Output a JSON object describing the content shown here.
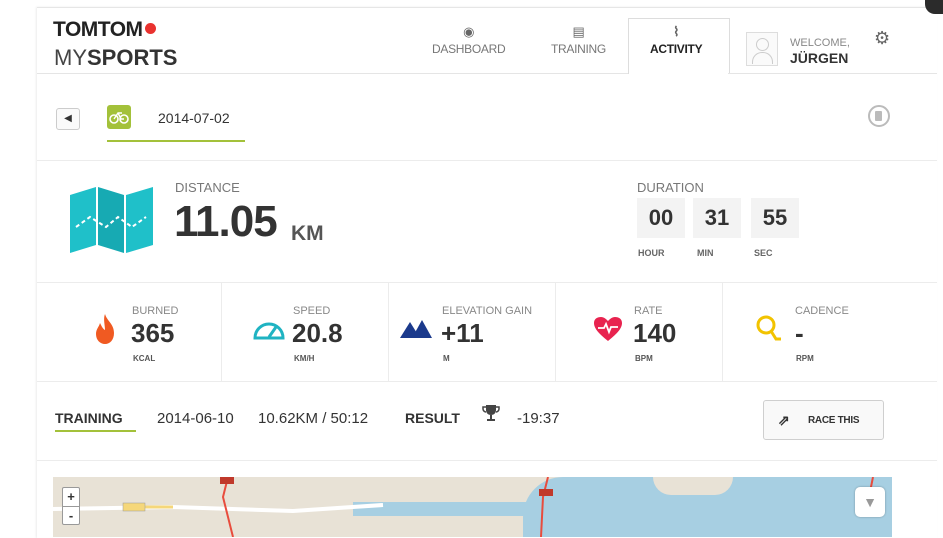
{
  "header": {
    "logo_top": "TOMTOM",
    "logo_bottom_prefix": "MY",
    "logo_bottom_suffix": "SPORTS",
    "nav": [
      {
        "label": "DASHBOARD",
        "icon": "◉"
      },
      {
        "label": "TRAINING",
        "icon": "▤"
      },
      {
        "label": "ACTIVITY",
        "icon": "⌇"
      }
    ],
    "welcome": "WELCOME,",
    "username": "JÜRGEN",
    "gear_icon": "⚙"
  },
  "activity": {
    "back_icon": "◀",
    "sport_icon": "⚗",
    "date": "2014-07-02"
  },
  "summary": {
    "distance_label": "DISTANCE",
    "distance_value": "11.05",
    "distance_unit": "KM",
    "duration_label": "DURATION",
    "hours": "00",
    "minutes": "31",
    "seconds": "55",
    "hour_label": "HOUR",
    "min_label": "MIN",
    "sec_label": "SEC"
  },
  "stats": [
    {
      "label": "BURNED",
      "value": "365",
      "unit": "KCAL",
      "icon": "flame-icon",
      "color": "#f05a22"
    },
    {
      "label": "SPEED",
      "value": "20.8",
      "unit": "KM/H",
      "icon": "speedometer-icon",
      "color": "#1fb3c2"
    },
    {
      "label": "ELEVATION GAIN",
      "value": "+11",
      "unit": "M",
      "icon": "mountain-icon",
      "color": "#1b3a8c"
    },
    {
      "label": "RATE",
      "value": "140",
      "unit": "BPM",
      "icon": "heart-icon",
      "color": "#e8234f"
    },
    {
      "label": "CADENCE",
      "value": "-",
      "unit": "RPM",
      "icon": "cadence-icon",
      "color": "#f2c300"
    }
  ],
  "training": {
    "label": "TRAINING",
    "date": "2014-06-10",
    "distance_time": "10.62KM / 50:12",
    "result_label": "RESULT",
    "result": "-19:37",
    "race_button": "RACE THIS"
  },
  "map": {
    "zoom_in": "+",
    "zoom_out": "-"
  },
  "colors": {
    "accent_green": "#a3c13a",
    "map_teal": "#1fc0c9"
  }
}
